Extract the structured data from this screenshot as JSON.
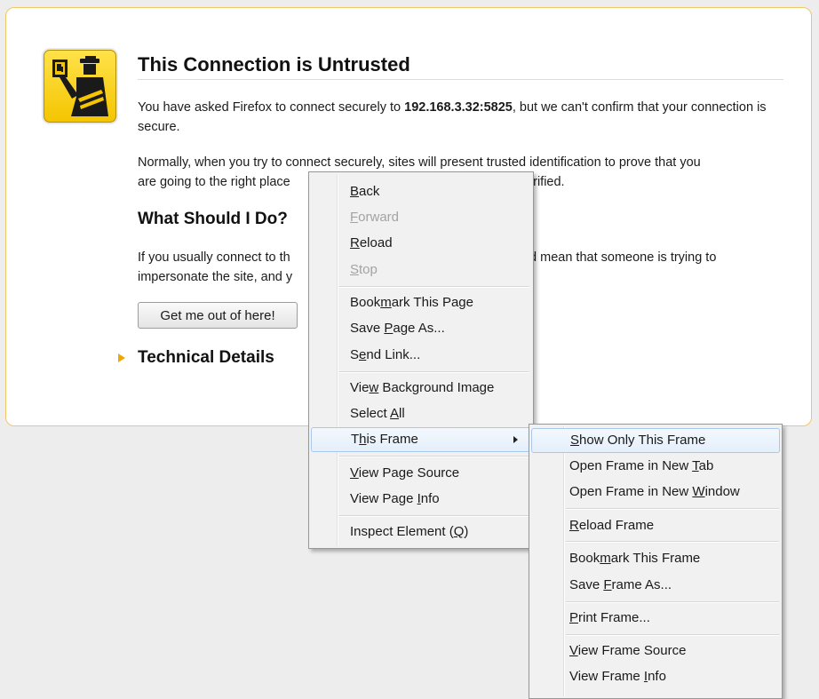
{
  "page": {
    "title": "This Connection is Untrusted",
    "intro_before": "You have asked Firefox to connect securely to ",
    "host": "192.168.3.32:5825",
    "intro_after": ", but we can't confirm that your connection is secure.",
    "normally_line1": "Normally, when you try to connect securely, sites will present trusted identification to prove that you",
    "normally_line2_start": "are going to the right place",
    "normally_line2_end": "e verified.",
    "what_heading": "What Should I Do?",
    "advice_line1_start": "If you usually connect to th",
    "advice_line1_end": "ould mean that someone is trying to",
    "advice_line2_start": "impersonate the site, and y",
    "get_out_button": "Get me out of here!",
    "technical_details": "Technical Details"
  },
  "context_menu": {
    "back": {
      "pre": "",
      "key": "B",
      "post": "ack"
    },
    "forward": {
      "pre": "",
      "key": "F",
      "post": "orward"
    },
    "reload": {
      "pre": "",
      "key": "R",
      "post": "eload"
    },
    "stop": {
      "pre": "",
      "key": "S",
      "post": "top"
    },
    "bookmark": {
      "pre": "Book",
      "key": "m",
      "post": "ark This Page"
    },
    "save_page": {
      "pre": "Save ",
      "key": "P",
      "post": "age As..."
    },
    "send_link": {
      "pre": "S",
      "key": "e",
      "post": "nd Link..."
    },
    "view_bg_image": {
      "pre": "Vie",
      "key": "w",
      "post": " Background Image"
    },
    "select_all": {
      "pre": "Select ",
      "key": "A",
      "post": "ll"
    },
    "this_frame": {
      "pre": "T",
      "key": "h",
      "post": "is Frame"
    },
    "view_source": {
      "pre": "",
      "key": "V",
      "post": "iew Page Source"
    },
    "view_info": {
      "pre": "View Page ",
      "key": "I",
      "post": "nfo"
    },
    "inspect": {
      "pre": "Inspect Element (",
      "key": "Q",
      "post": ")"
    }
  },
  "frame_submenu": {
    "show_only": {
      "pre": "",
      "key": "S",
      "post": "how Only This Frame"
    },
    "open_tab": {
      "pre": "Open Frame in New ",
      "key": "T",
      "post": "ab"
    },
    "open_window": {
      "pre": "Open Frame in New ",
      "key": "W",
      "post": "indow"
    },
    "reload_frame": {
      "pre": "",
      "key": "R",
      "post": "eload Frame"
    },
    "bookmark_frame": {
      "pre": "Book",
      "key": "m",
      "post": "ark This Frame"
    },
    "save_frame": {
      "pre": "Save ",
      "key": "F",
      "post": "rame As..."
    },
    "print_frame": {
      "pre": "",
      "key": "P",
      "post": "rint Frame..."
    },
    "view_frame_source": {
      "pre": "",
      "key": "V",
      "post": "iew Frame Source"
    },
    "view_frame_info": {
      "pre": "View Frame ",
      "key": "I",
      "post": "nfo"
    }
  },
  "colors": {
    "accent_yellow": "#f4c500",
    "box_border": "#f0c66a",
    "highlight": "#e4effb",
    "disabled_text": "#a3a3a3"
  },
  "icons": [
    "untrusted-connection-icon",
    "technical-details-arrow-icon",
    "submenu-arrow-icon"
  ]
}
